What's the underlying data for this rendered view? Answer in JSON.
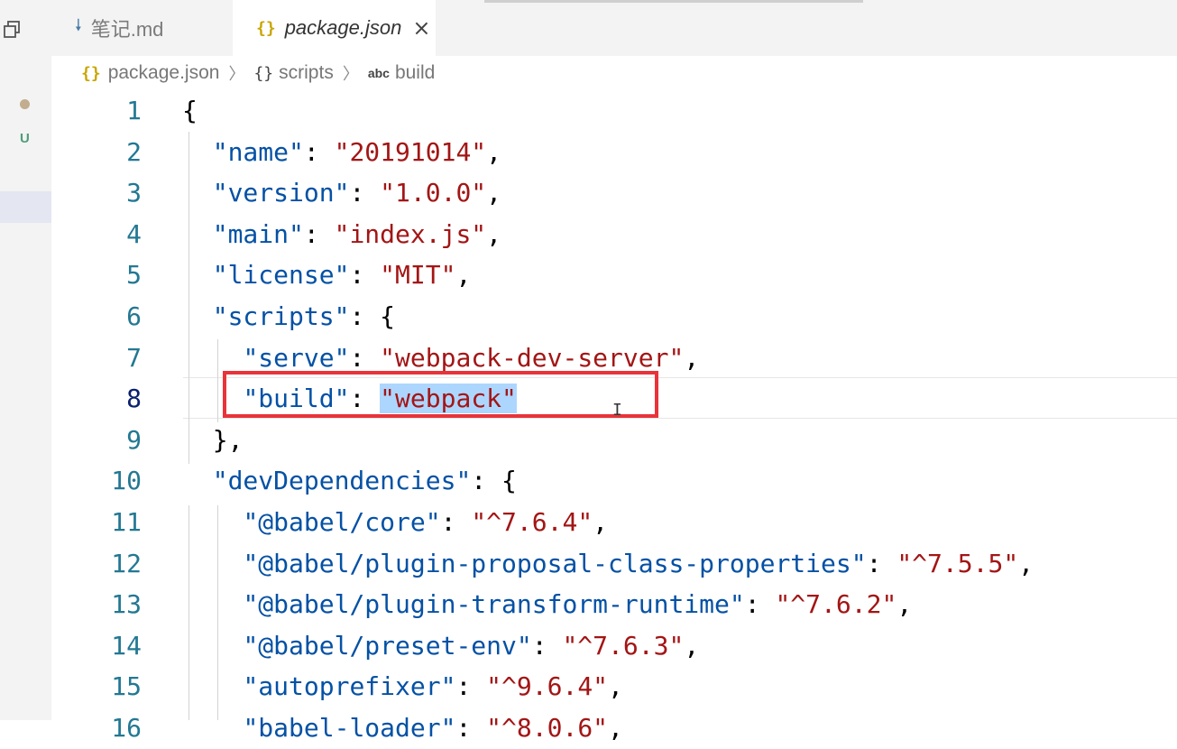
{
  "tabs": [
    {
      "label": "笔记.md",
      "icon": "markdown-download-icon",
      "active": false
    },
    {
      "label": "package.json",
      "icon": "json-braces-icon",
      "active": true,
      "close": "×"
    }
  ],
  "breadcrumb": {
    "file": "package.json",
    "file_icon": "{}",
    "object": "scripts",
    "object_icon": "{}",
    "key_icon": "abc",
    "key": "build"
  },
  "side": {
    "u_badge": "U"
  },
  "editor": {
    "current_line": 8,
    "lines": [
      {
        "n": "1",
        "tokens": [
          {
            "t": "{",
            "c": "p"
          }
        ]
      },
      {
        "n": "2",
        "tokens": [
          {
            "t": "  ",
            "c": "p"
          },
          {
            "t": "\"name\"",
            "c": "k"
          },
          {
            "t": ": ",
            "c": "p"
          },
          {
            "t": "\"20191014\"",
            "c": "s"
          },
          {
            "t": ",",
            "c": "p"
          }
        ]
      },
      {
        "n": "3",
        "tokens": [
          {
            "t": "  ",
            "c": "p"
          },
          {
            "t": "\"version\"",
            "c": "k"
          },
          {
            "t": ": ",
            "c": "p"
          },
          {
            "t": "\"1.0.0\"",
            "c": "s"
          },
          {
            "t": ",",
            "c": "p"
          }
        ]
      },
      {
        "n": "4",
        "tokens": [
          {
            "t": "  ",
            "c": "p"
          },
          {
            "t": "\"main\"",
            "c": "k"
          },
          {
            "t": ": ",
            "c": "p"
          },
          {
            "t": "\"index.js\"",
            "c": "s"
          },
          {
            "t": ",",
            "c": "p"
          }
        ]
      },
      {
        "n": "5",
        "tokens": [
          {
            "t": "  ",
            "c": "p"
          },
          {
            "t": "\"license\"",
            "c": "k"
          },
          {
            "t": ": ",
            "c": "p"
          },
          {
            "t": "\"MIT\"",
            "c": "s"
          },
          {
            "t": ",",
            "c": "p"
          }
        ]
      },
      {
        "n": "6",
        "tokens": [
          {
            "t": "  ",
            "c": "p"
          },
          {
            "t": "\"scripts\"",
            "c": "k"
          },
          {
            "t": ": {",
            "c": "p"
          }
        ]
      },
      {
        "n": "7",
        "tokens": [
          {
            "t": "    ",
            "c": "p"
          },
          {
            "t": "\"serve\"",
            "c": "k"
          },
          {
            "t": ": ",
            "c": "p"
          },
          {
            "t": "\"webpack-dev-server\"",
            "c": "s"
          },
          {
            "t": ",",
            "c": "p"
          }
        ]
      },
      {
        "n": "8",
        "tokens": [
          {
            "t": "    ",
            "c": "p"
          },
          {
            "t": "\"build\"",
            "c": "k"
          },
          {
            "t": ": ",
            "c": "p"
          },
          {
            "t": "\"webpack\"",
            "c": "s hl"
          }
        ]
      },
      {
        "n": "9",
        "tokens": [
          {
            "t": "  },",
            "c": "p"
          }
        ]
      },
      {
        "n": "10",
        "tokens": [
          {
            "t": "  ",
            "c": "p"
          },
          {
            "t": "\"devDependencies\"",
            "c": "k"
          },
          {
            "t": ": {",
            "c": "p"
          }
        ]
      },
      {
        "n": "11",
        "tokens": [
          {
            "t": "    ",
            "c": "p"
          },
          {
            "t": "\"@babel/core\"",
            "c": "k"
          },
          {
            "t": ": ",
            "c": "p"
          },
          {
            "t": "\"^7.6.4\"",
            "c": "s"
          },
          {
            "t": ",",
            "c": "p"
          }
        ]
      },
      {
        "n": "12",
        "tokens": [
          {
            "t": "    ",
            "c": "p"
          },
          {
            "t": "\"@babel/plugin-proposal-class-properties\"",
            "c": "k"
          },
          {
            "t": ": ",
            "c": "p"
          },
          {
            "t": "\"^7.5.5\"",
            "c": "s"
          },
          {
            "t": ",",
            "c": "p"
          }
        ]
      },
      {
        "n": "13",
        "tokens": [
          {
            "t": "    ",
            "c": "p"
          },
          {
            "t": "\"@babel/plugin-transform-runtime\"",
            "c": "k"
          },
          {
            "t": ": ",
            "c": "p"
          },
          {
            "t": "\"^7.6.2\"",
            "c": "s"
          },
          {
            "t": ",",
            "c": "p"
          }
        ]
      },
      {
        "n": "14",
        "tokens": [
          {
            "t": "    ",
            "c": "p"
          },
          {
            "t": "\"@babel/preset-env\"",
            "c": "k"
          },
          {
            "t": ": ",
            "c": "p"
          },
          {
            "t": "\"^7.6.3\"",
            "c": "s"
          },
          {
            "t": ",",
            "c": "p"
          }
        ]
      },
      {
        "n": "15",
        "tokens": [
          {
            "t": "    ",
            "c": "p"
          },
          {
            "t": "\"autoprefixer\"",
            "c": "k"
          },
          {
            "t": ": ",
            "c": "p"
          },
          {
            "t": "\"^9.6.4\"",
            "c": "s"
          },
          {
            "t": ",",
            "c": "p"
          }
        ]
      },
      {
        "n": "16",
        "tokens": [
          {
            "t": "    ",
            "c": "p"
          },
          {
            "t": "\"babel-loader\"",
            "c": "k"
          },
          {
            "t": ": ",
            "c": "p"
          },
          {
            "t": "\"^8.0.6\"",
            "c": "s"
          },
          {
            "t": ",",
            "c": "p"
          }
        ]
      }
    ]
  },
  "colors": {
    "key": "#0451a5",
    "string": "#a31515",
    "line_number": "#237893",
    "annotation_box": "#e8333a",
    "selection": "#add6ff"
  }
}
